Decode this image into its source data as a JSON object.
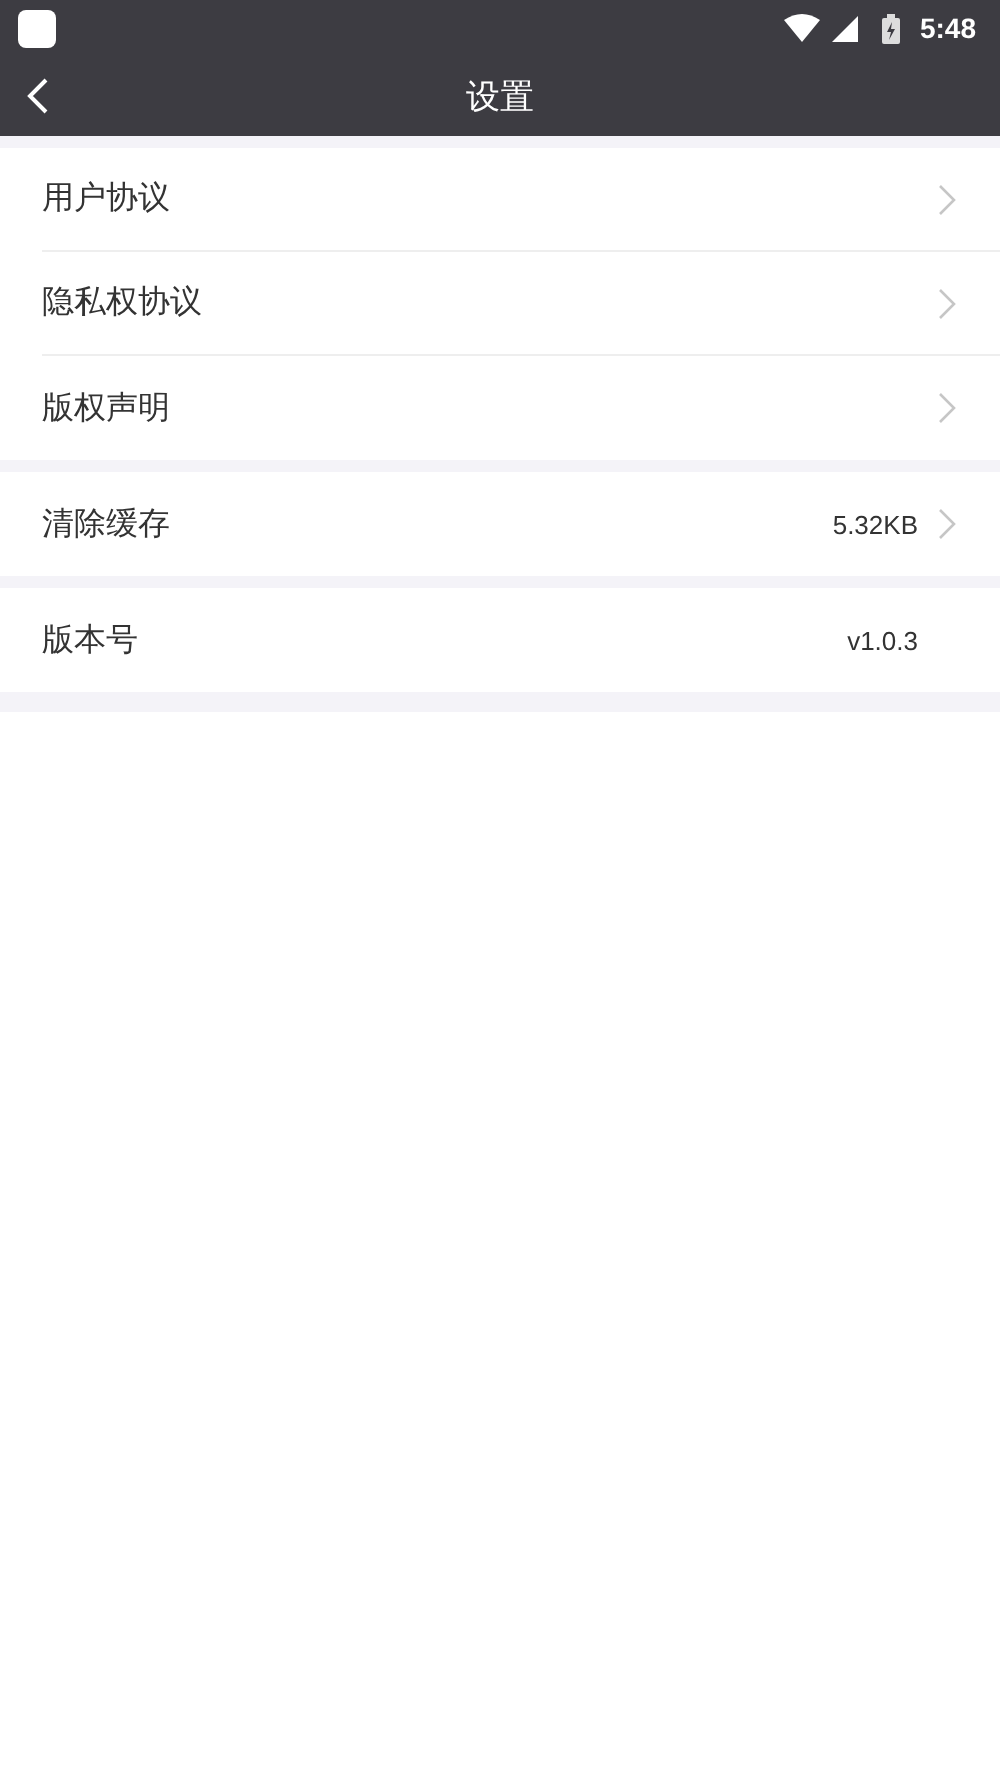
{
  "status_bar": {
    "time": "5:48"
  },
  "nav_bar": {
    "title": "设置"
  },
  "groups": [
    {
      "items": [
        {
          "label": "用户协议",
          "arrow": true
        },
        {
          "label": "隐私权协议",
          "arrow": true
        },
        {
          "label": "版权声明",
          "arrow": true
        }
      ]
    },
    {
      "items": [
        {
          "label": "清除缓存",
          "value": "5.32KB",
          "arrow": true
        }
      ]
    },
    {
      "items": [
        {
          "label": "版本号",
          "value": "v1.0.3",
          "arrow": false
        }
      ]
    }
  ]
}
